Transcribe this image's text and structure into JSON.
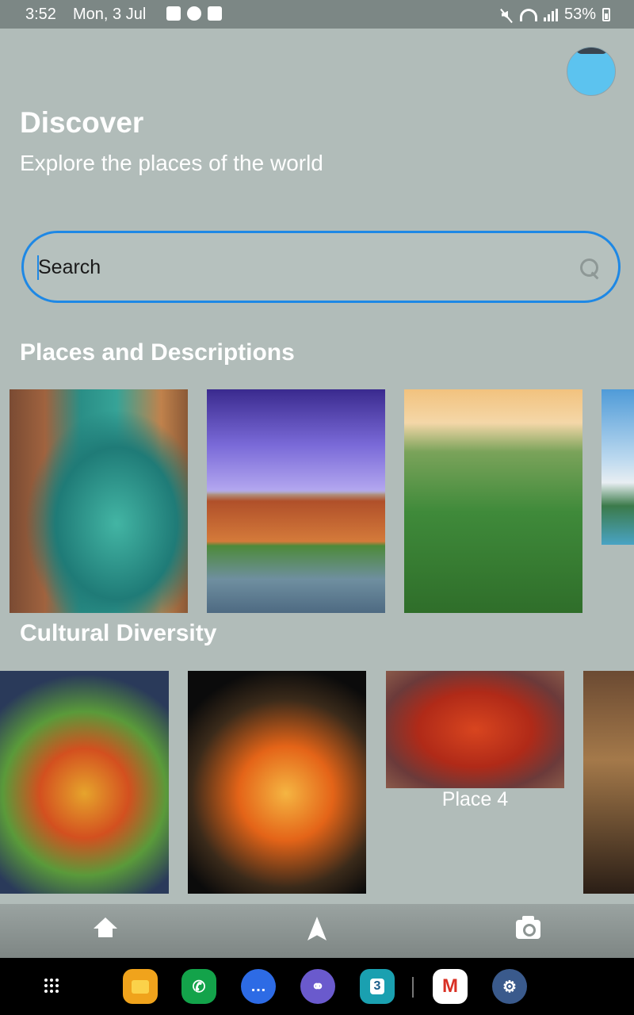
{
  "status_bar": {
    "time": "3:52",
    "date": "Mon, 3 Jul",
    "battery": "53%"
  },
  "header": {
    "title": "Discover",
    "subtitle": "Explore the places of the world"
  },
  "search": {
    "placeholder": "Search",
    "value": "",
    "accent": "#1e88e5"
  },
  "sections": {
    "places": {
      "title": "Places and Descriptions"
    },
    "cultural": {
      "title": "Cultural Diversity",
      "card_label": "Place 4"
    }
  },
  "bottom_nav": {
    "items": [
      "home-icon",
      "navigation-icon",
      "camera-icon"
    ]
  },
  "taskbar": {
    "calendar_day": "3"
  },
  "colors": {
    "background": "#b1bcb9",
    "avatar": "#5cc3ef"
  }
}
